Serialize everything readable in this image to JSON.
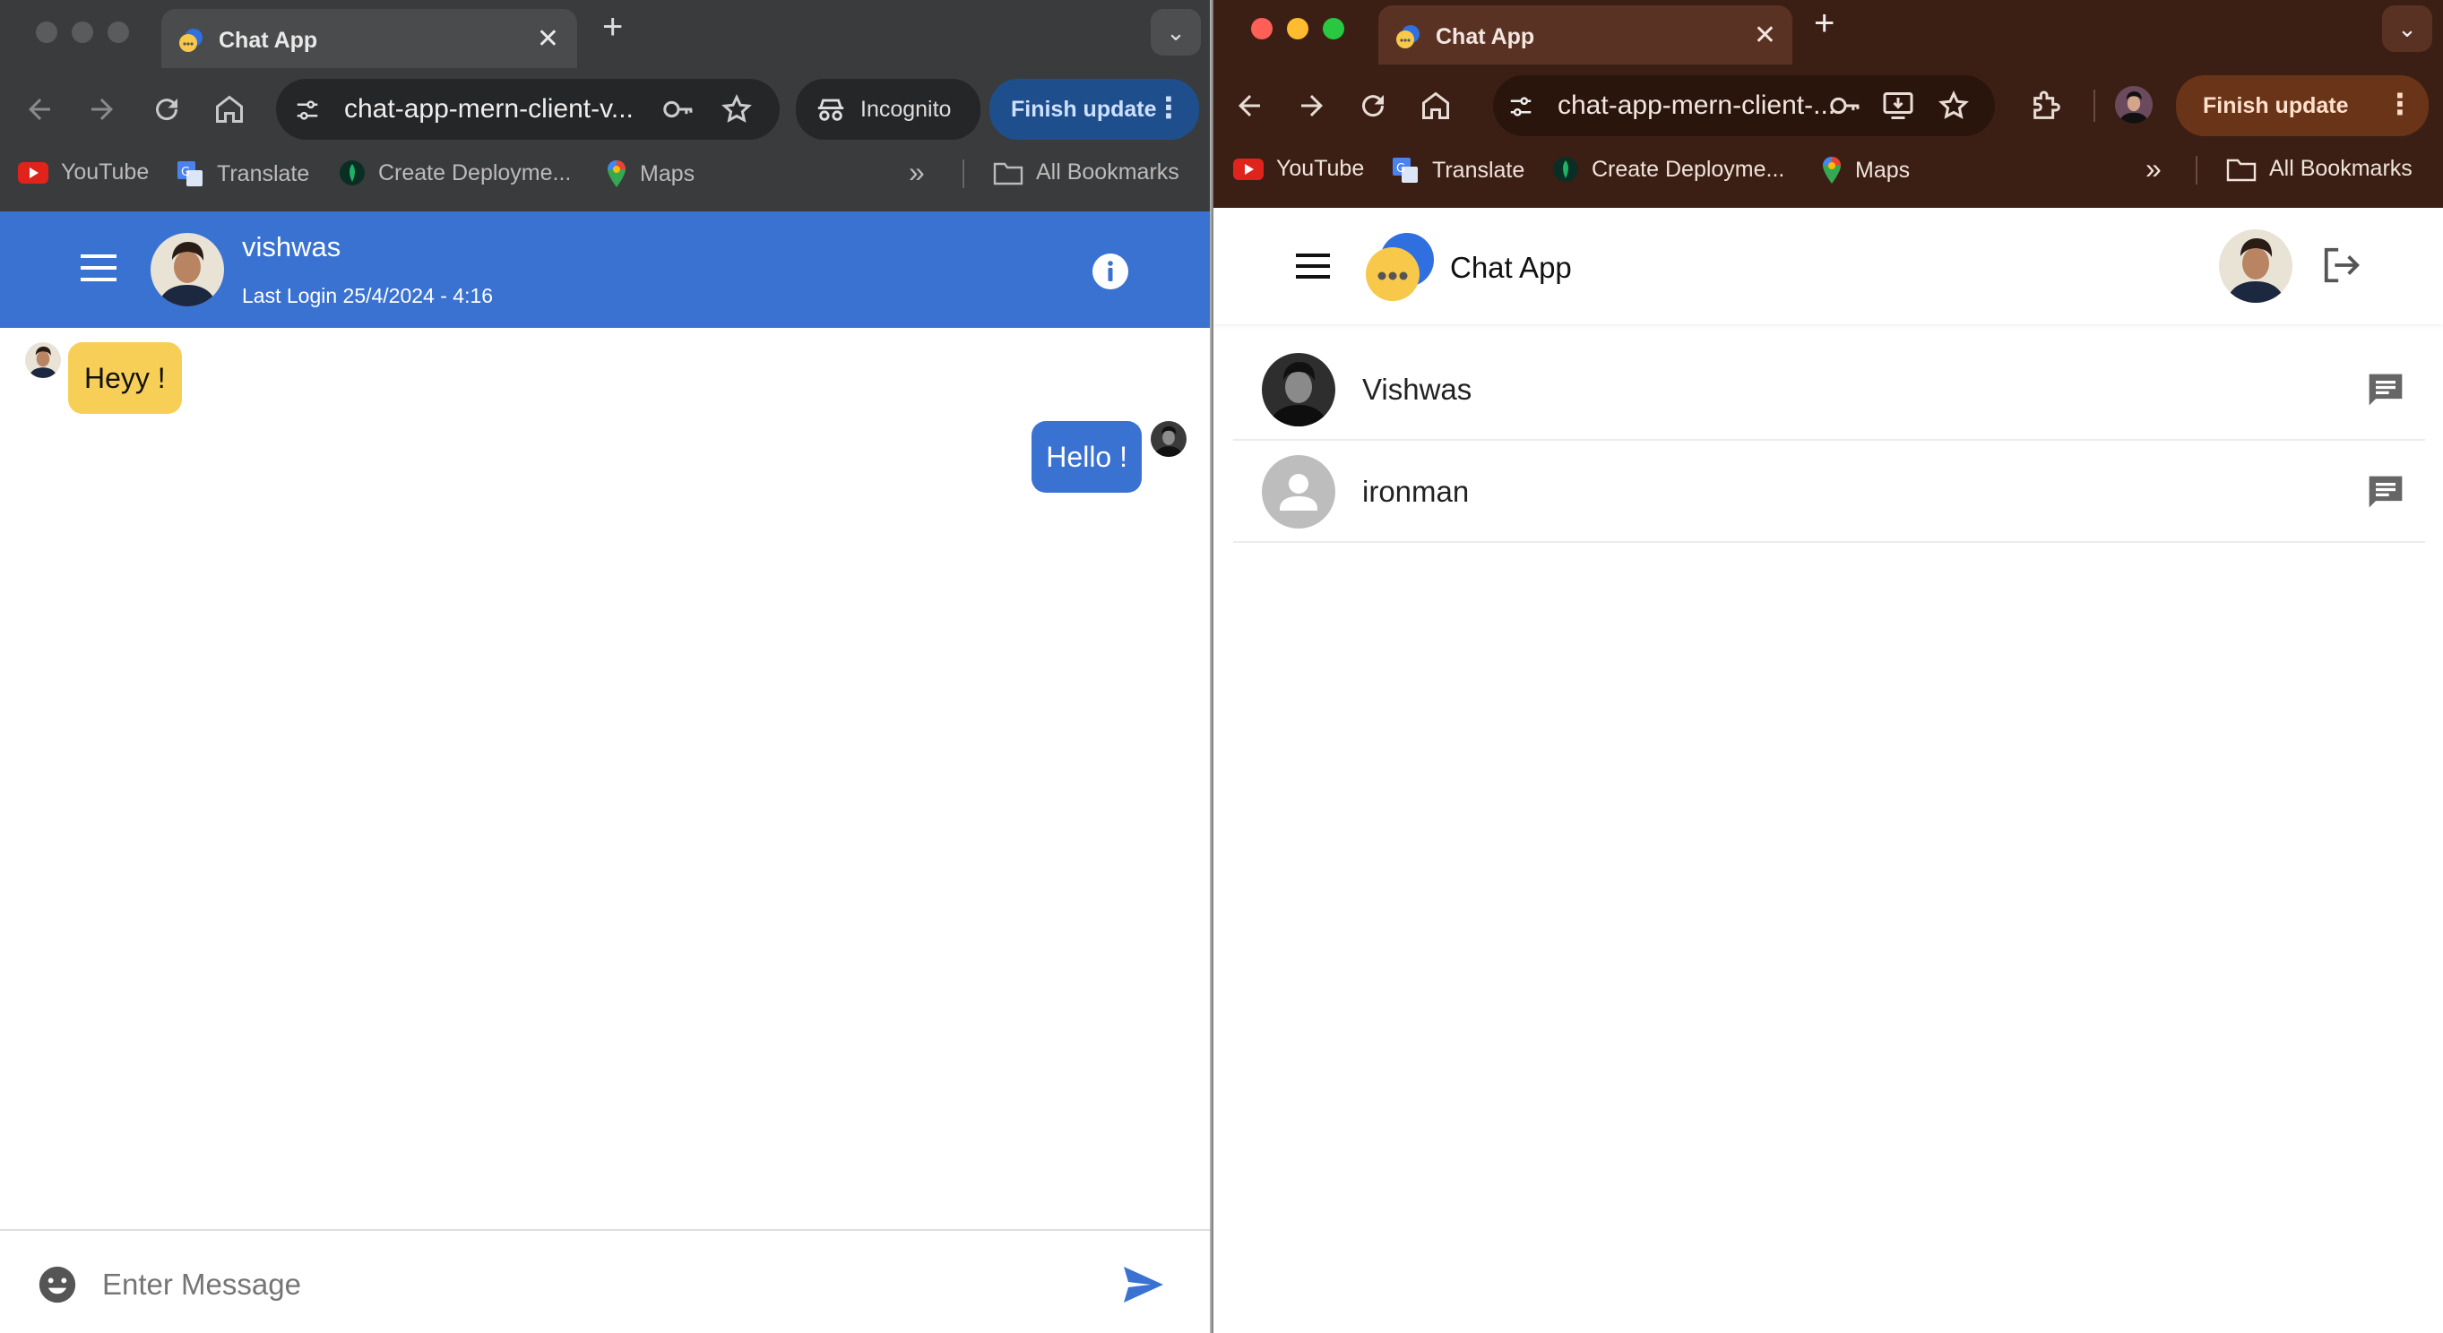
{
  "left_window": {
    "tab_title": "Chat App",
    "url": "chat-app-mern-client-v...",
    "incognito_label": "Incognito",
    "update_label": "Finish update",
    "bookmarks": [
      {
        "label": "YouTube",
        "icon": "youtube-icon"
      },
      {
        "label": "Translate",
        "icon": "translate-icon"
      },
      {
        "label": "Create Deployme...",
        "icon": "mongodb-leaf-icon"
      },
      {
        "label": "Maps",
        "icon": "maps-pin-icon"
      }
    ],
    "all_bookmarks": "All Bookmarks",
    "chat": {
      "name": "vishwas",
      "last_login": "Last Login 25/4/2024 - 4:16",
      "messages": [
        {
          "text": "Heyy !",
          "side": "left"
        },
        {
          "text": "Hello !",
          "side": "right"
        }
      ],
      "input_placeholder": "Enter Message"
    },
    "colors": {
      "header": "#3a72d2",
      "received_bubble": "#f7cf57",
      "sent_bubble": "#3a72d2"
    }
  },
  "right_window": {
    "tab_title": "Chat App",
    "url": "chat-app-mern-client-...",
    "update_label": "Finish update",
    "bookmarks": [
      {
        "label": "YouTube",
        "icon": "youtube-icon"
      },
      {
        "label": "Translate",
        "icon": "translate-icon"
      },
      {
        "label": "Create Deployme...",
        "icon": "mongodb-leaf-icon"
      },
      {
        "label": "Maps",
        "icon": "maps-pin-icon"
      }
    ],
    "all_bookmarks": "All Bookmarks",
    "app_title": "Chat App",
    "users": [
      {
        "name": "Vishwas",
        "avatar": "photo"
      },
      {
        "name": "ironman",
        "avatar": "default-person-icon"
      }
    ]
  }
}
